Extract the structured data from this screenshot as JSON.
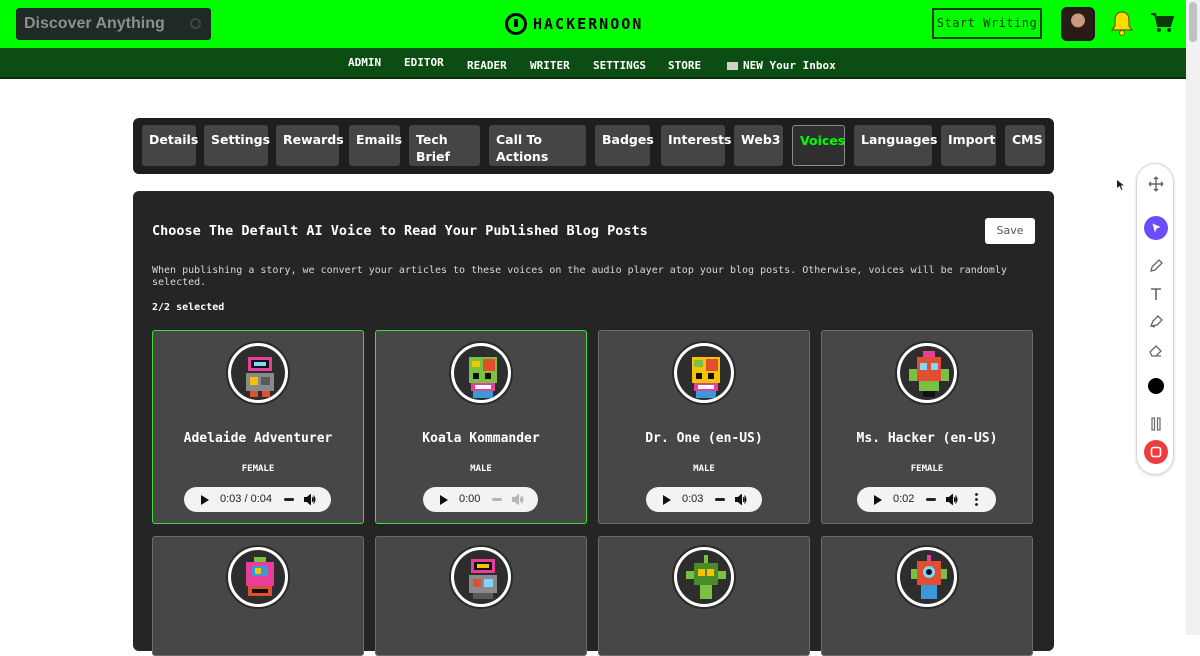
{
  "header": {
    "search_placeholder": "Discover Anything",
    "logo_text": "HACKERNOON",
    "start_writing": "Start Writing"
  },
  "subnav": {
    "items": [
      "ADMIN",
      "EDITOR",
      "READER",
      "WRITER",
      "SETTINGS",
      "STORE",
      "NEW Your Inbox"
    ]
  },
  "tabs": {
    "items": [
      "Details",
      "Settings",
      "Rewards",
      "Emails",
      "Tech\nBrief",
      "Call To\nActions",
      "Badges",
      "Interests",
      "Web3",
      "Voices",
      "Languages",
      "Import",
      "CMS"
    ],
    "active": "Voices"
  },
  "panel": {
    "title": "Choose The Default AI Voice to Read Your Published Blog Posts",
    "save_label": "Save",
    "description": "When publishing a story, we convert your articles to these voices on the audio player atop your blog posts. Otherwise, voices will be randomly selected.",
    "selected_count": "2/2 selected"
  },
  "voices": [
    {
      "name": "Adelaide Adventurer",
      "gender": "FEMALE",
      "time": "0:03 / 0:04",
      "selected": true
    },
    {
      "name": "Koala Kommander",
      "gender": "MALE",
      "time": "0:00",
      "selected": true
    },
    {
      "name": "Dr. One (en-US)",
      "gender": "MALE",
      "time": "0:03",
      "selected": false
    },
    {
      "name": "Ms. Hacker (en-US)",
      "gender": "FEMALE",
      "time": "0:02",
      "selected": false
    }
  ],
  "colors": {
    "brand_green": "#00ff00",
    "subnav_green": "#0b4d12",
    "panel_bg": "#252525",
    "card_bg": "#474747",
    "selected_border": "#3fdc3f"
  },
  "icons": {
    "search": "search-icon",
    "bell": "bell-icon",
    "cart": "cart-icon",
    "inbox": "inbox-icon"
  }
}
